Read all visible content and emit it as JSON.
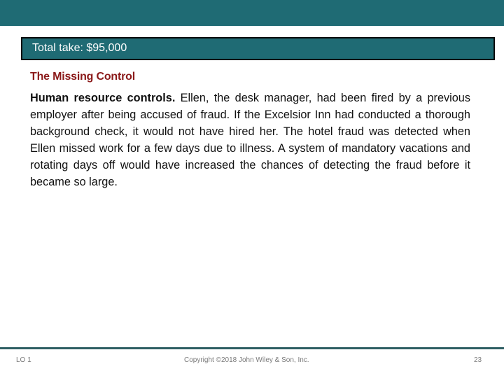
{
  "callout": {
    "text": "Total take: $95,000"
  },
  "section": {
    "heading": "The Missing Control",
    "lead_bold": "Human resource controls.",
    "body": " Ellen, the desk manager, had been fired by a previous employer after being accused of fraud. If the Excelsior Inn had conducted a thorough background check, it would not have hired her. The hotel fraud was detected when Ellen missed work for a few days due to illness. A system of mandatory vacations and rotating days off would have increased the chances of detecting the fraud before it became so large."
  },
  "footer": {
    "learning_objective": "LO 1",
    "copyright": "Copyright ©2018 John Wiley & Son, Inc.",
    "page_number": "23"
  },
  "colors": {
    "brand_teal": "#1f6b74",
    "heading_red": "#8b1a1a",
    "footer_rule": "#2f5f63"
  }
}
